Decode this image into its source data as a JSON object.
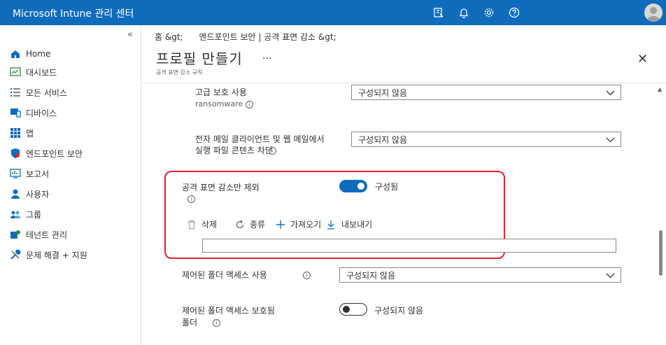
{
  "app": {
    "title": "Microsoft Intune 관리 센터"
  },
  "topbar": {
    "icons": [
      "feedback-icon",
      "bell-icon",
      "gear-icon",
      "help-icon"
    ]
  },
  "sidebar": {
    "collapse": "«",
    "items": [
      {
        "label": "Home",
        "icon": "home-icon",
        "color": "#0f6cbd"
      },
      {
        "label": "대시보드",
        "icon": "dashboard-icon",
        "color": "#2d8a3e"
      },
      {
        "label": "모든 서비스",
        "icon": "list-icon",
        "color": "#605e5c"
      },
      {
        "label": "디바이스",
        "icon": "device-icon",
        "color": "#0f6cbd"
      },
      {
        "label": "앱",
        "icon": "apps-grid-icon",
        "color": "#0f6cbd"
      },
      {
        "label": "엔드포인트 보안",
        "icon": "shield-icon",
        "color": "#0f6cbd"
      },
      {
        "label": "보고서",
        "icon": "report-icon",
        "color": "#0f6cbd"
      },
      {
        "label": "사용자",
        "icon": "user-icon",
        "color": "#0f6cbd"
      },
      {
        "label": "그룹",
        "icon": "group-icon",
        "color": "#0f6cbd"
      },
      {
        "label": "테넌트 관리",
        "icon": "tenant-icon",
        "color": "#0f6cbd"
      },
      {
        "label": "문제 해결 + 지원",
        "icon": "wrench-icon",
        "color": "#0f6cbd"
      }
    ]
  },
  "main": {
    "breadcrumb": "홈 &gt;      엔드포인트 보안 | 공격 표면 감소 &gt;",
    "title": "프로필 만들기",
    "more": "...",
    "subtitle": "공격 표면 감소 규칙",
    "close": "✕"
  },
  "settings": {
    "advanced_protection": {
      "label": "고급 보호 사용",
      "sublabel": "ransomware",
      "value": "구성되지 않음"
    },
    "email_exec": {
      "label_line1": "전자 메일 클라이언트 및 웹 메일에서",
      "label_line2": "실행 파일 콘텐츠 차단",
      "value": "구성되지 않음"
    },
    "asr_exclusions": {
      "label": "공격 표면 감소만 제외",
      "toggle_label": "구성됨",
      "toggle_on": true,
      "toolbar": {
        "delete": "삭제",
        "sort": "종류",
        "import": "가져오기",
        "export": "내보내기"
      }
    },
    "controlled_folder": {
      "label": "제어된 폴더 액세스 사용",
      "value": "구성되지 않음"
    },
    "controlled_folder_protected": {
      "label_line1": "제어된 폴더 액세스 보호됨",
      "label_line2": "폴더",
      "toggle_label": "구성되지 않음",
      "toggle_on": false
    }
  },
  "info_glyph": "i",
  "colors": {
    "brand": "#0f6cbd",
    "highlight": "#e3212b"
  }
}
